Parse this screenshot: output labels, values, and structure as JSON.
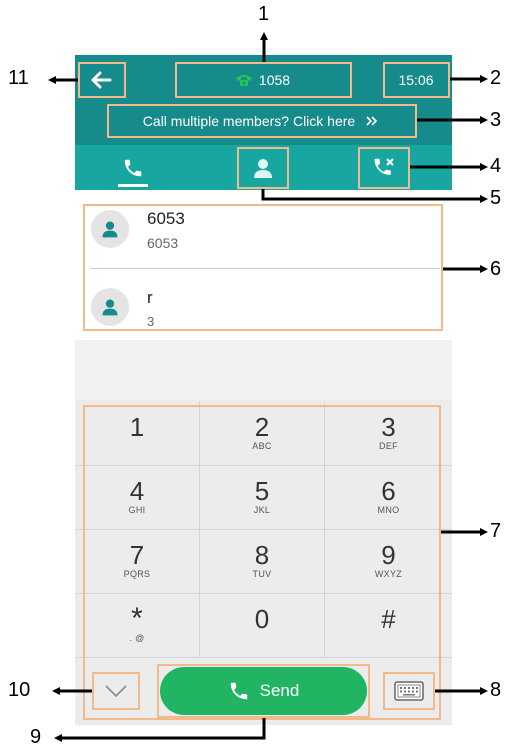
{
  "callouts": [
    "1",
    "2",
    "3",
    "4",
    "5",
    "6",
    "7",
    "8",
    "9",
    "10",
    "11"
  ],
  "topbar": {
    "line_number": "1058",
    "time": "15:06",
    "multi_members_label": "Call multiple members? Click here"
  },
  "contacts": [
    {
      "name": "6053",
      "number": "6053"
    },
    {
      "name": "r",
      "number": "3"
    }
  ],
  "keypad": {
    "keys": [
      {
        "digit": "1",
        "letters": ""
      },
      {
        "digit": "2",
        "letters": "ABC"
      },
      {
        "digit": "3",
        "letters": "DEF"
      },
      {
        "digit": "4",
        "letters": "GHI"
      },
      {
        "digit": "5",
        "letters": "JKL"
      },
      {
        "digit": "6",
        "letters": "MNO"
      },
      {
        "digit": "7",
        "letters": "PQRS"
      },
      {
        "digit": "8",
        "letters": "TUV"
      },
      {
        "digit": "9",
        "letters": "WXYZ"
      },
      {
        "digit": "*",
        "letters": ". @"
      },
      {
        "digit": "0",
        "letters": ""
      },
      {
        "digit": "#",
        "letters": ""
      }
    ],
    "send_label": "Send"
  },
  "colors": {
    "topbar": "#168b8c",
    "tabbar": "#18a6a0",
    "send": "#21b463",
    "phone_icon": "#25c650",
    "highlight": "#f2b98a"
  },
  "icons": [
    "back-arrow-icon",
    "phone-icon",
    "double-chevron-right-icon",
    "handset-icon",
    "contact-person-icon",
    "call-history-icon",
    "chevron-down-icon",
    "keyboard-icon"
  ]
}
